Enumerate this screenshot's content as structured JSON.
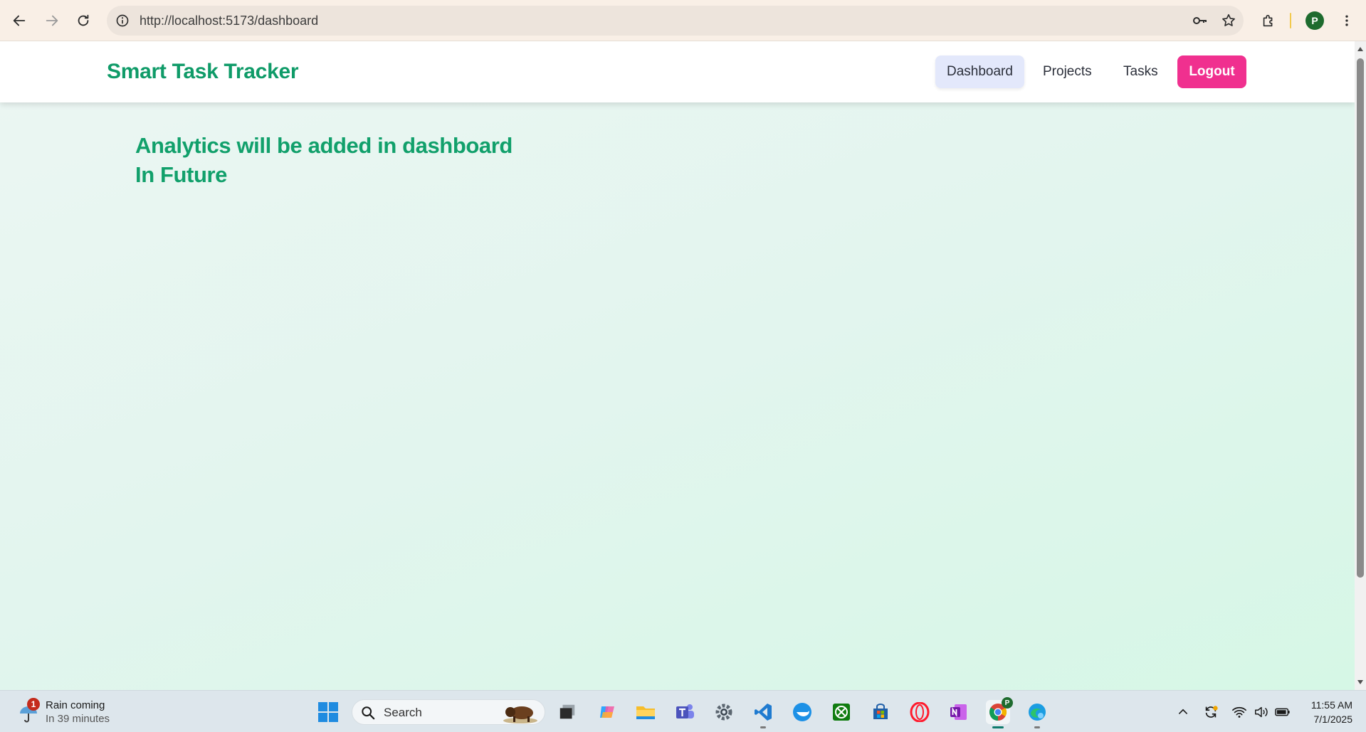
{
  "browser": {
    "url": "http://localhost:5173/dashboard",
    "profile_initial": "P"
  },
  "app": {
    "brand": "Smart Task Tracker",
    "nav": {
      "dashboard": "Dashboard",
      "projects": "Projects",
      "tasks": "Tasks",
      "logout": "Logout"
    },
    "headline_line1": "Analytics will be added in dashboard",
    "headline_line2": "In Future"
  },
  "taskbar": {
    "weather": {
      "badge": "1",
      "title": "Rain coming",
      "subtitle": "In 39 minutes"
    },
    "search_label": "Search",
    "chrome_badge": "P",
    "time": "11:55 AM",
    "date": "7/1/2025",
    "apps": [
      "windows-start",
      "search",
      "task-view",
      "copilot",
      "file-explorer",
      "teams",
      "settings",
      "vscode",
      "docker",
      "xbox",
      "microsoft-store",
      "opera",
      "onenote",
      "chrome",
      "edge"
    ]
  },
  "colors": {
    "brand_green": "#0f9b68",
    "logout_pink": "#f0308f",
    "active_nav_bg": "#e3e8fb"
  }
}
